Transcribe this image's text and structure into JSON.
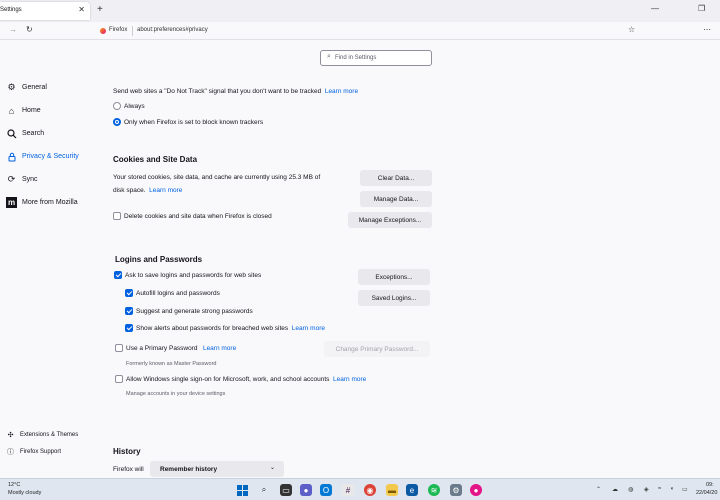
{
  "tabbar": {
    "tab_title": "Settings",
    "close": "✕",
    "new_tab": "+",
    "minimize": "—",
    "maximize": "❐",
    "win_close": "✕"
  },
  "navbar": {
    "back": "←",
    "forward": "→",
    "reload": "↻",
    "brand": "Firefox",
    "url": "about:preferences#privacy",
    "bookmark": "☆",
    "extension": "⋯"
  },
  "sidebar": {
    "items": [
      {
        "label": "General",
        "icon": "gear-icon"
      },
      {
        "label": "Home",
        "icon": "home-icon"
      },
      {
        "label": "Search",
        "icon": "search-icon"
      },
      {
        "label": "Privacy & Security",
        "icon": "lock-icon"
      },
      {
        "label": "Sync",
        "icon": "sync-icon"
      },
      {
        "label": "More from Mozilla",
        "icon": "mozilla-icon"
      }
    ],
    "footer": [
      {
        "label": "Extensions & Themes",
        "icon": "puzzle-icon"
      },
      {
        "label": "Firefox Support",
        "icon": "help-icon"
      }
    ]
  },
  "search": {
    "placeholder": "Find in Settings"
  },
  "dnt": {
    "text": "Send web sites a \"Do Not Track\" signal that you don't want to be tracked",
    "learn_more": "Learn more",
    "always": "Always",
    "only_when": "Only when Firefox is set to block known trackers"
  },
  "cookies": {
    "heading": "Cookies and Site Data",
    "desc_line1": "Your stored cookies, site data, and cache are currently using 25.3 MB of",
    "desc_line2": "disk space.",
    "learn_more": "Learn more",
    "clear_button": "Clear Data...",
    "manage_button": "Manage Data...",
    "exceptions_button": "Manage Exceptions...",
    "delete_on_close": "Delete cookies and site data when Firefox is closed"
  },
  "logins": {
    "heading": "Logins and Passwords",
    "ask_to_save": "Ask to save logins and passwords for web sites",
    "autofill": "Autofill logins and passwords",
    "suggest": "Suggest and generate strong passwords",
    "alerts": "Show alerts about passwords for breached web sites",
    "alerts_learn_more": "Learn more",
    "primary_password": "Use a Primary Password",
    "primary_learn_more": "Learn more",
    "primary_note": "Formerly known as Master Password",
    "sso": "Allow Windows single sign-on for Microsoft, work, and school accounts",
    "sso_learn_more": "Learn more",
    "sso_note": "Manage accounts in your device settings",
    "exceptions_button": "Exceptions...",
    "saved_logins_button": "Saved Logins...",
    "change_primary_button": "Change Primary Password..."
  },
  "history": {
    "heading": "History",
    "label": "Firefox will",
    "select_value": "Remember history",
    "chevron": "⌄"
  },
  "taskbar": {
    "temp": "12°C",
    "weather": "Mostly cloudy",
    "time": "09:",
    "date": "22/04/20"
  },
  "colors": {
    "accent": "#0061e0",
    "button": "#e9e9ed",
    "background": "#f9f9fb"
  }
}
